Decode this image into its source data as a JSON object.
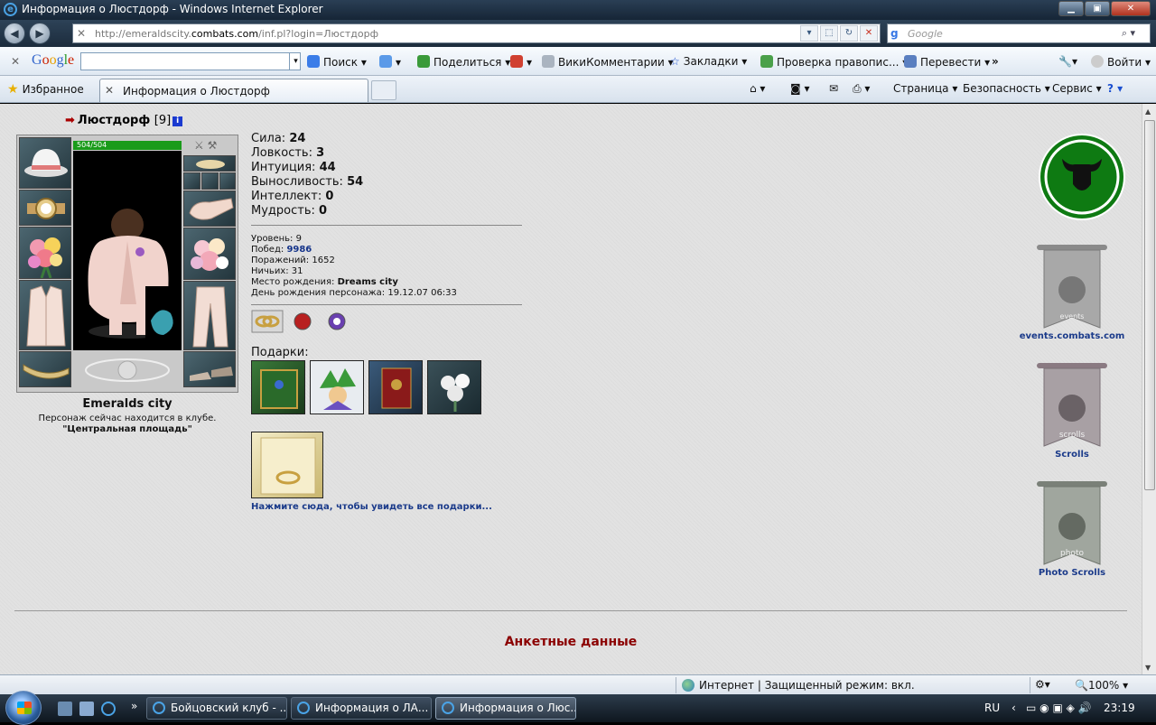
{
  "window": {
    "title": "Информация о Люстдорф - Windows Internet Explorer"
  },
  "address": {
    "url_prefix": "http://emeraldscity.",
    "url_domain": "combats.com",
    "url_suffix": "/inf.pl?login=Люстдорф"
  },
  "search": {
    "placeholder": "Google"
  },
  "google_toolbar": {
    "logo": [
      "G",
      "o",
      "o",
      "g",
      "l",
      "e"
    ],
    "search": "Поиск",
    "share": "Поделиться",
    "wiki": "ВикиКомментарии",
    "bookmarks": "Закладки",
    "spell": "Проверка правопис...",
    "translate": "Перевести",
    "more": "»",
    "signin": "Войти"
  },
  "favorites": {
    "label": "Избранное"
  },
  "tab": {
    "label": "Информация о Люстдорф"
  },
  "commands": {
    "page": "Страница",
    "safety": "Безопасность",
    "tools": "Сервис"
  },
  "character": {
    "name": "Люстдорф",
    "level": "[9]",
    "info_icon": "i",
    "hp": "504/504",
    "city": "Emeralds city",
    "location_text": "Персонаж сейчас находится в клубе.",
    "location_place": "\"Центральная площадь\""
  },
  "stats": {
    "strength_label": "Сила:",
    "strength": "24",
    "agility_label": "Ловкость:",
    "agility": "3",
    "intuition_label": "Интуиция:",
    "intuition": "44",
    "endurance_label": "Выносливость:",
    "endurance": "54",
    "intellect_label": "Интеллект:",
    "intellect": "0",
    "wisdom_label": "Мудрость:",
    "wisdom": "0"
  },
  "info": {
    "level_label": "Уровень:",
    "level": "9",
    "wins_label": "Побед:",
    "wins": "9986",
    "losses_label": "Поражений:",
    "losses": "1652",
    "draws_label": "Ничьих:",
    "draws": "31",
    "birthplace_label": "Место рождения:",
    "birthplace": "Dreams city",
    "birthday_label": "День рождения персонажа:",
    "birthday": "19.12.07 06:33"
  },
  "gifts": {
    "label": "Подарки:",
    "link": "Нажмите сюда, чтобы увидеть все подарки..."
  },
  "sidebar": {
    "events": "events.combats.com",
    "scrolls": "Scrolls",
    "photo": "Photo Scrolls",
    "events_banner_text": "events",
    "scrolls_banner_text": "scrolls",
    "photo_banner_text": "photo"
  },
  "section": {
    "title": "Анкетные данные"
  },
  "statusbar": {
    "zone": "Интернет | Защищенный режим: вкл.",
    "zoom": "100%"
  },
  "taskbar": {
    "tasks": [
      "Бойцовский клуб - ...",
      "Информация о ЛА...",
      "Информация о Люс..."
    ],
    "more": "»",
    "lang": "RU",
    "clock": "23:19"
  },
  "colors": {
    "accent": "#1a3a8a",
    "section": "#8b0000",
    "hp": "#1a9b1a",
    "logo_green": "#0e7a12"
  }
}
